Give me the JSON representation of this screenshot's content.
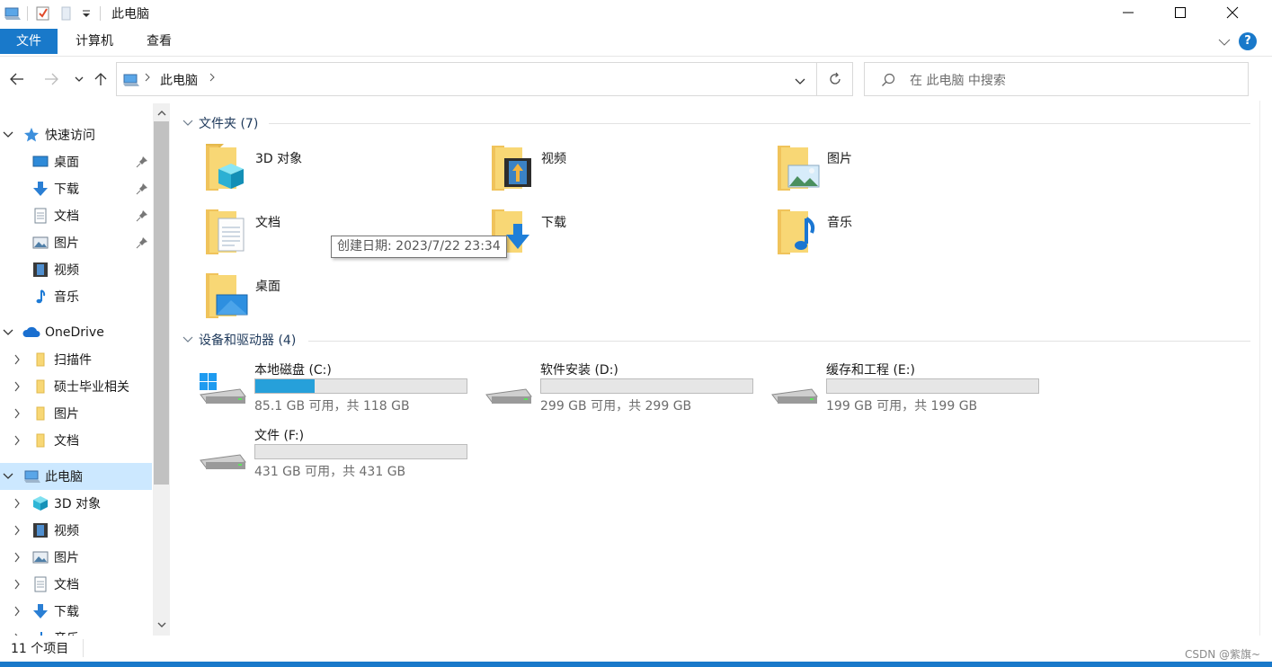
{
  "window": {
    "title": "此电脑"
  },
  "ribbon": {
    "tabs": [
      "文件",
      "计算机",
      "查看"
    ]
  },
  "address": {
    "path": "此电脑",
    "separator": ">"
  },
  "search": {
    "placeholder": "在 此电脑 中搜索"
  },
  "sidebar": {
    "quick_access": "快速访问",
    "quick_items": [
      "桌面",
      "下载",
      "文档",
      "图片",
      "视频",
      "音乐"
    ],
    "onedrive": "OneDrive",
    "onedrive_items": [
      "扫描件",
      "硕士毕业相关",
      "图片",
      "文档"
    ],
    "this_pc": "此电脑",
    "pc_items": [
      "3D 对象",
      "视频",
      "图片",
      "文档",
      "下载",
      "音乐"
    ]
  },
  "content": {
    "folders_header": "文件夹 (7)",
    "folders": [
      "3D 对象",
      "视频",
      "图片",
      "文档",
      "下载",
      "音乐",
      "桌面"
    ],
    "drives_header": "设备和驱动器 (4)",
    "drives": [
      {
        "name": "本地磁盘 (C:)",
        "free": "85.1 GB 可用，共 118 GB",
        "used_fraction": 0.28
      },
      {
        "name": "软件安装 (D:)",
        "free": "299 GB 可用，共 299 GB",
        "used_fraction": 0.0
      },
      {
        "name": "缓存和工程 (E:)",
        "free": "199 GB 可用，共 199 GB",
        "used_fraction": 0.0
      },
      {
        "name": "文件 (F:)",
        "free": "431 GB 可用，共 431 GB",
        "used_fraction": 0.0
      }
    ],
    "tooltip": "创建日期: 2023/7/22 23:34"
  },
  "status": {
    "item_count": "11 个项目",
    "watermark": "CSDN @紫旗~"
  },
  "colors": {
    "accent": "#1979ca",
    "selection": "#cce8ff",
    "drive_fill": "#26a0da",
    "folder_yellow": "#f8d775"
  }
}
